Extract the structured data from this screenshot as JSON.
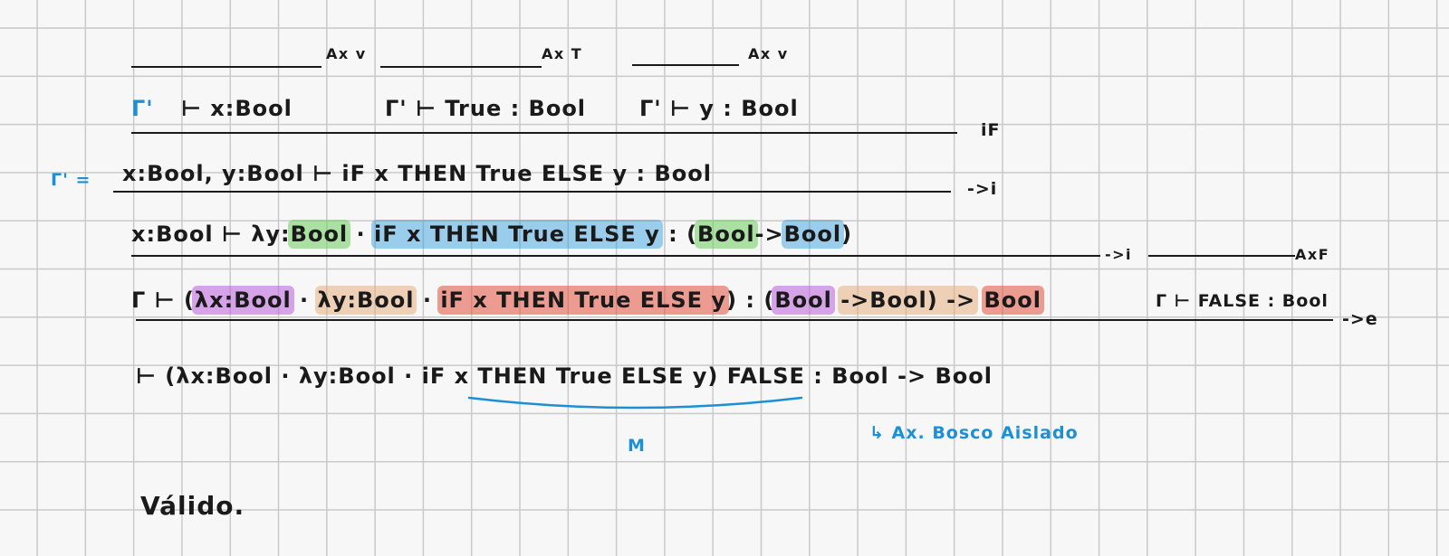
{
  "rules": {
    "axv_1": "Ax v",
    "axt": "Ax T",
    "axv_2": "Ax v",
    "if": "iF",
    "arrow_i_1": "->i",
    "arrow_i_2": "->i",
    "axf": "AxF",
    "arrow_e": "->e"
  },
  "row1": {
    "ctx1": "Γ'",
    "j1": "⊢ x:Bool",
    "j2": "Γ' ⊢ True : Bool",
    "j3": "Γ' ⊢ y : Bool"
  },
  "row2": {
    "gamma_def": "Γ' =",
    "j": "x:Bool, y:Bool ⊢ iF x THEN True ELSE y : Bool"
  },
  "row3": {
    "prefix": "x:Bool ⊢ λy:",
    "bool_1": "Bool",
    "dot": "·",
    "body": "iF x THEN True ELSE y",
    "colon": ": (",
    "bool_2": "Bool",
    "arrow": "->",
    "bool_3": "Bool",
    "close": ")"
  },
  "row4": {
    "gamma_turnstile": "Γ ⊢ (",
    "lam_x": "λx:Bool",
    "dot1": "·",
    "lam_y": "λy:Bool",
    "dot2": "·",
    "body": "iF x THEN True ELSE y",
    "close_colon": ") : (",
    "bool_a": "Bool",
    "arrow_mid": "->Bool) ->",
    "bool_b": "Bool",
    "false_judgment": "Γ ⊢ FALSE : Bool"
  },
  "row5": {
    "conclusion": "⊢ (λx:Bool · λy:Bool · iF x THEN True ELSE y) FALSE : Bool -> Bool",
    "m_label": "M",
    "note": "↳ Ax. Bosco Aislado"
  },
  "verdict": "Válido."
}
